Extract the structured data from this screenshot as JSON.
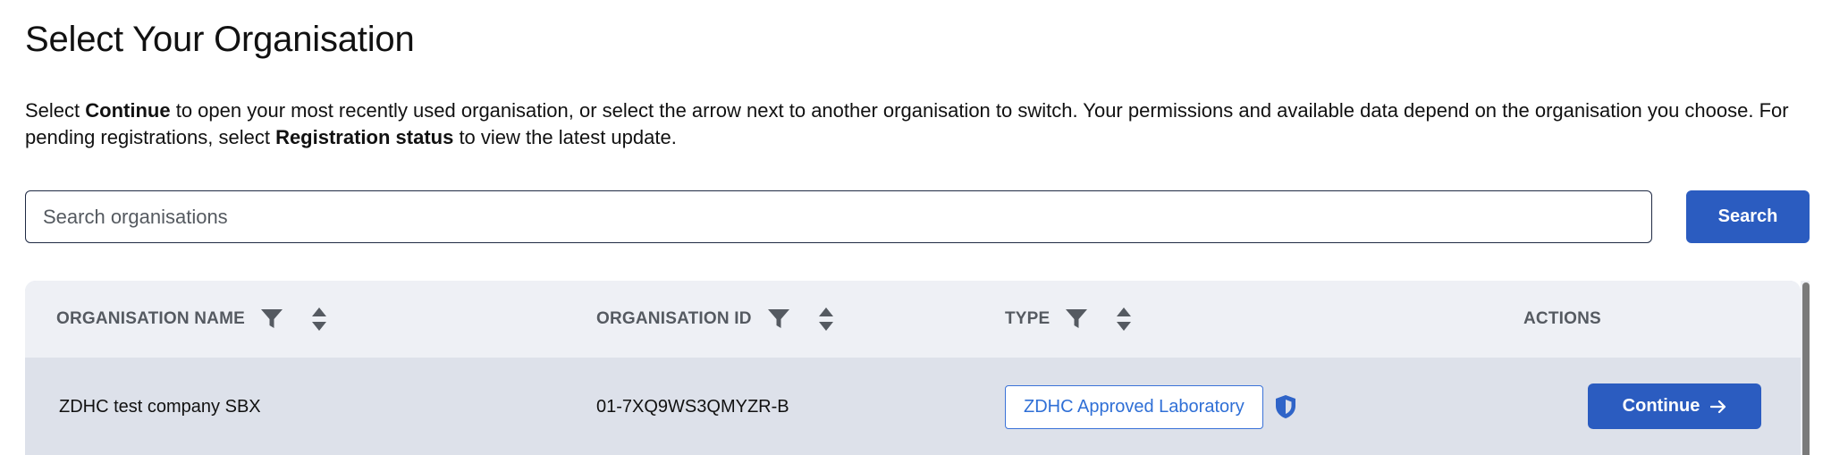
{
  "page": {
    "title": "Select Your Organisation",
    "intro": {
      "part1": "Select ",
      "bold1": "Continue",
      "part2": " to open your most recently used organisation, or select the arrow next to another organisation to switch. Your permissions and available data depend on the organisation you choose. For pending registrations, select ",
      "bold2": "Registration status",
      "part3": " to view the latest update."
    }
  },
  "search": {
    "placeholder": "Search organisations",
    "value": "",
    "button_label": "Search"
  },
  "table": {
    "columns": [
      {
        "label": "ORGANISATION NAME",
        "filterable": true,
        "sortable": true
      },
      {
        "label": "ORGANISATION ID",
        "filterable": true,
        "sortable": true
      },
      {
        "label": "TYPE",
        "filterable": true,
        "sortable": true
      },
      {
        "label": "ACTIONS",
        "filterable": false,
        "sortable": false
      }
    ],
    "rows": [
      {
        "name": "ZDHC test company SBX",
        "id": "01-7XQ9WS3QMYZR-B",
        "type": "ZDHC Approved Laboratory",
        "type_icon": "shield-icon",
        "action_label": "Continue",
        "action_icon": "arrow-right-icon"
      }
    ]
  },
  "colors": {
    "primary": "#2b5cc0",
    "badge_text": "#2f6fd6",
    "header_bg": "#eef0f5",
    "row_bg": "#dde1ea"
  }
}
